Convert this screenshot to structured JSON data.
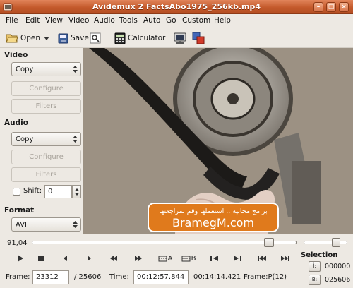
{
  "window": {
    "title": "Avidemux 2 FactsAbo1975_256kb.mp4"
  },
  "menu": [
    "File",
    "Edit",
    "View",
    "Video",
    "Audio",
    "Tools",
    "Auto",
    "Go",
    "Custom",
    "Help"
  ],
  "toolbar": {
    "open": "Open",
    "save": "Save",
    "calculator": "Calculator"
  },
  "video_section": {
    "heading": "Video",
    "codec": "Copy",
    "configure": "Configure",
    "filters": "Filters"
  },
  "audio_section": {
    "heading": "Audio",
    "codec": "Copy",
    "configure": "Configure",
    "filters": "Filters",
    "shift_label": "Shift:",
    "shift_value": "0"
  },
  "format_section": {
    "heading": "Format",
    "container": "AVI"
  },
  "preview": {
    "watermark_arabic": "برامج مجانية .. استعملها وقم بمراجعتها",
    "watermark_site": "BramegM.com"
  },
  "seek": {
    "position_label": "91,04",
    "position_fraction": 0.91,
    "volume_fraction": 0.8
  },
  "transport": {
    "marker_a": "A",
    "marker_b": "B",
    "buttons": [
      "play-icon",
      "stop-icon",
      "prev-frame-icon",
      "next-frame-icon",
      "rewind-icon",
      "fast-forward-icon",
      "set-marker-a-icon",
      "set-marker-b-icon",
      "prev-keyframe-icon",
      "next-keyframe-icon",
      "go-start-icon",
      "go-end-icon"
    ]
  },
  "status": {
    "frame_label": "Frame:",
    "frame_value": "23312",
    "frame_total": "/ 25606",
    "time_label": "Time:",
    "time_value": "00:12:57.844",
    "duration": "00:14:14.421",
    "frame_type": "Frame:P(12)"
  },
  "selection": {
    "label": "Selection",
    "a_icon": "ﺃ:",
    "a_value": "000000",
    "b_icon": "B:",
    "b_value": "025606"
  },
  "colors": {
    "titlebar": "#c45a2c",
    "window_bg": "#ede9e3",
    "watermark_bg": "#e07a1c"
  }
}
